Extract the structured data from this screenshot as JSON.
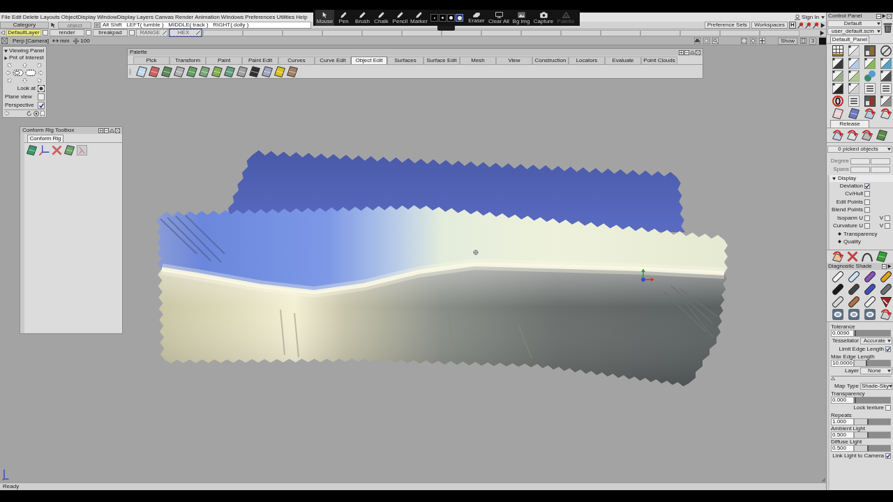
{
  "menu_bar": {
    "items": [
      "File",
      "Edit",
      "Delete",
      "Layouts",
      "ObjectDisplay",
      "WindowDisplay",
      "Layers",
      "Canvas",
      "Render",
      "Animation",
      "Windows",
      "Preferences",
      "Utilities",
      "Help"
    ],
    "sign_in": "Sign In"
  },
  "marker_toolbar": {
    "tools": [
      {
        "label": "Mouse",
        "selected": true
      },
      {
        "label": "Pen",
        "selected": false
      },
      {
        "label": "Brush",
        "selected": false
      },
      {
        "label": "Chalk",
        "selected": false
      },
      {
        "label": "Pencil",
        "selected": false
      },
      {
        "label": "Marker",
        "selected": false
      }
    ],
    "brush_sizes": [
      {
        "selected": false
      },
      {
        "selected": false
      },
      {
        "selected": false
      },
      {
        "selected": true
      }
    ],
    "actions": [
      {
        "label": "Eraser",
        "disabled": false
      },
      {
        "label": "Clear All",
        "disabled": false
      },
      {
        "label": "Bg img",
        "disabled": false
      },
      {
        "label": "Capture",
        "disabled": false
      },
      {
        "label": "Palette",
        "disabled": true
      }
    ]
  },
  "toolbar": {
    "category": "Category",
    "object_field": {
      "placeholder": "object"
    },
    "mouse_hint": "Alt Shift   LEFT( tumble )   MIDDLE( track )   RIGHT( dolly )",
    "buttons": [
      "Preference Sets",
      "Workspaces"
    ],
    "icon_button_label": "H"
  },
  "layer_bar": {
    "layers": [
      {
        "name": "DefaultLayer",
        "current": true,
        "hidden": false,
        "selected": false,
        "checked": false
      },
      {
        "name": "render",
        "current": false,
        "hidden": false,
        "selected": false,
        "checked": false
      },
      {
        "name": "breakpad",
        "current": false,
        "hidden": false,
        "selected": false,
        "checked": false
      },
      {
        "name": "RANGE",
        "current": false,
        "hidden": true,
        "selected": false
      },
      {
        "name": "HEX",
        "current": false,
        "hidden": true,
        "selected": true
      }
    ]
  },
  "view_bar": {
    "camera": "Perp [Camera]",
    "units": "mm",
    "scale": "100",
    "show_button": "Show",
    "pane_button": "3"
  },
  "palette": {
    "title": "Palette",
    "tabs": [
      {
        "label": "Pick",
        "selected": false
      },
      {
        "label": "Transform",
        "selected": false
      },
      {
        "label": "Paint",
        "selected": false
      },
      {
        "label": "Paint Edit",
        "selected": false
      },
      {
        "label": "Curves",
        "selected": false
      },
      {
        "label": "Curve Edit",
        "selected": false
      },
      {
        "label": "Object Edit",
        "selected": true
      },
      {
        "label": "Surfaces",
        "selected": false
      },
      {
        "label": "Surface Edit",
        "selected": false
      },
      {
        "label": "Mesh",
        "selected": false
      },
      {
        "label": "View",
        "selected": false
      },
      {
        "label": "Construction",
        "selected": false
      },
      {
        "label": "Locators",
        "selected": false
      },
      {
        "label": "Evaluate",
        "selected": false
      },
      {
        "label": "Point Clouds",
        "selected": false
      }
    ]
  },
  "viewing_panel": {
    "title": "Viewing Panel",
    "expanded": true,
    "point_of_interest": {
      "label": "Pnt of Interest",
      "expanded": false
    },
    "look_at": "Look at",
    "options": [
      {
        "label": "Plane view",
        "checked": false
      },
      {
        "label": "Perspective",
        "checked": true
      }
    ]
  },
  "conform_rig_toolbox": {
    "title": "Conform Rig Toolbox",
    "tab": "Conform Rig"
  },
  "control_panel": {
    "title": "Control Panel",
    "preset": "Default",
    "file": "user_default.scm",
    "panel_tab": "Default_Panel",
    "release_tab": "Release",
    "picked": "0 picked objects",
    "fields": [
      {
        "label": "Degree"
      },
      {
        "label": "Spans"
      }
    ],
    "display": {
      "title": "Display",
      "expanded": true,
      "options": [
        {
          "label": "Deviation",
          "checked": true
        },
        {
          "label": "Cv/Hull",
          "checked": false
        },
        {
          "label": "Edit Points",
          "checked": false
        },
        {
          "label": "Blend Points",
          "checked": false
        },
        {
          "label": "Isoparm U",
          "checked": false,
          "v_label": "V",
          "v_checked": false
        },
        {
          "label": "Curvature U",
          "checked": false,
          "v_label": "V",
          "v_checked": false
        }
      ],
      "subsections": [
        "Transparency",
        "Quality"
      ]
    }
  },
  "diagnostic_shade": {
    "title": "Diagnostic Shade",
    "settings": [
      {
        "kind": "slider",
        "label": "Tolerance",
        "value": "0.0090",
        "level": 0.0
      },
      {
        "kind": "dropdown",
        "label": "Tessellator",
        "value": "Accurate"
      },
      {
        "kind": "checkbox",
        "label": "Limit Edge Length",
        "checked": true
      },
      {
        "kind": "slider",
        "label": "Max Edge Length",
        "value": "10.0000",
        "level": 0.35
      },
      {
        "kind": "dropdown",
        "label": "Layer",
        "value": "None"
      },
      {
        "kind": "divider"
      },
      {
        "kind": "dropdown",
        "label": "Map Type",
        "value": "Shade-Sky"
      },
      {
        "kind": "slider",
        "label": "Transparency",
        "value": "0.000",
        "level": 0.0
      },
      {
        "kind": "checkbox",
        "label": "Lock texture",
        "checked": false
      },
      {
        "kind": "slider",
        "label": "Repeats",
        "value": "1.000",
        "level": 0.4
      },
      {
        "kind": "slider",
        "label": "Ambient Light",
        "value": "0.500",
        "level": 0.4
      },
      {
        "kind": "slider",
        "label": "Diffuse Light",
        "value": "0.500",
        "level": 0.4
      },
      {
        "kind": "checkbox",
        "label": "Link Light to Camera",
        "checked": true
      }
    ]
  },
  "status_bar": {
    "text": "Ready"
  }
}
